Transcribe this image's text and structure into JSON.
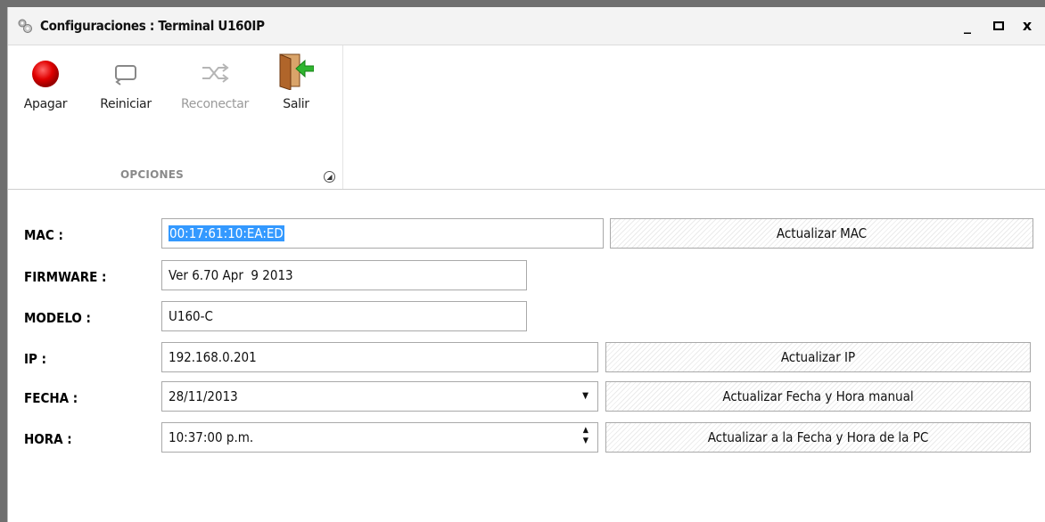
{
  "window": {
    "title": "Configuraciones : Terminal U160IP",
    "controls": {
      "minimize": "_",
      "maximize": "▫",
      "close": "x"
    }
  },
  "ribbon": {
    "buttons": [
      {
        "label": "Apagar",
        "icon": "red-circle-icon",
        "enabled": true
      },
      {
        "label": "Reiniciar",
        "icon": "restart-icon",
        "enabled": true
      },
      {
        "label": "Reconectar",
        "icon": "shuffle-icon",
        "enabled": false
      },
      {
        "label": "Salir",
        "icon": "exit-door-icon",
        "enabled": true
      }
    ],
    "group_label": "OPCIONES"
  },
  "form": {
    "mac": {
      "label": "MAC :",
      "value": "00:17:61:10:EA:ED",
      "button": "Actualizar MAC"
    },
    "firmware": {
      "label": "FIRMWARE :",
      "value": "Ver 6.70 Apr  9 2013"
    },
    "modelo": {
      "label": "MODELO :",
      "value": "U160-C"
    },
    "ip": {
      "label": "IP :",
      "value": "192.168.0.201",
      "button": "Actualizar IP"
    },
    "fecha": {
      "label": "FECHA :",
      "value": "28/11/2013",
      "button": "Actualizar Fecha y Hora manual"
    },
    "hora": {
      "label": "HORA :",
      "value": "10:37:00 p.m.",
      "button": "Actualizar a la Fecha y Hora de la PC"
    }
  },
  "colors": {
    "selection": "#3399ff",
    "power_red": "#e00000",
    "exit_green": "#2fb52f",
    "door_brown": "#b0652a"
  }
}
